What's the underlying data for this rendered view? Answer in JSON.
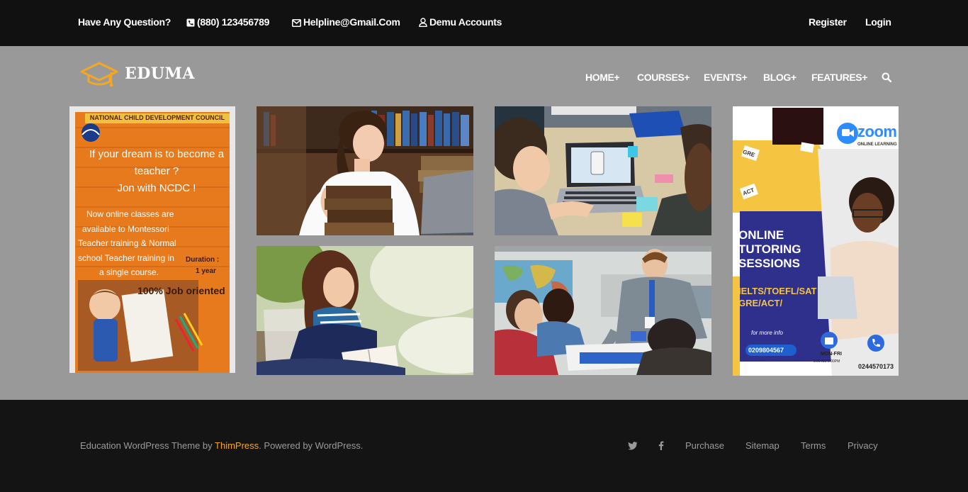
{
  "topbar": {
    "question": "Have Any Question?",
    "phone": "(880) 123456789",
    "email": "Helpline@Gmail.Com",
    "demo": "Demu Accounts",
    "register": "Register",
    "login": "Login"
  },
  "header": {
    "logo_text": "EDUMA",
    "nav": [
      "HOME+",
      "COURSES+",
      "EVENTS+",
      "BLOG+",
      "FEATURES+"
    ]
  },
  "poster_left": {
    "org": "NATIONAL CHILD DEVELOPMENT COUNCIL",
    "line1": "If your dream is to become a",
    "line2": "teacher ?",
    "line3": "Jon with NCDC !",
    "line4": "Now online classes are",
    "line5": "available  to Montessori",
    "line6": "Teacher training  &  Normal",
    "line7": "school  Teacher training in",
    "line8": "a  single course.",
    "duration_label": "Duration  :",
    "duration_value": "1 year",
    "badge": "100% Job oriented"
  },
  "poster_right": {
    "brand": "zoom",
    "brand_sub": "ONLINE LEARNING",
    "title1": "ONLINE",
    "title2": "TUTORING",
    "title3": "SESSIONS",
    "tests1": "IELTS/TOEFL/SAT",
    "tests2": "GRE/ACT/",
    "more": "for more info",
    "phone1": "0209804567",
    "days": "MON-FRI",
    "hours": "9:00 AM-8:00PM",
    "phone2": "0244570173",
    "tag_gre": "GRE",
    "tag_act": "ACT"
  },
  "footer": {
    "credit_prefix": "Education WordPress Theme by ",
    "credit_brand": "ThimPress",
    "credit_suffix": ". Powered by WordPress.",
    "links": [
      "Purchase",
      "Sitemap",
      "Terms",
      "Privacy"
    ]
  },
  "colors": {
    "topbar_bg": "#111111",
    "main_bg": "#999999",
    "footer_bg": "#141414",
    "accent": "#f5a623"
  }
}
